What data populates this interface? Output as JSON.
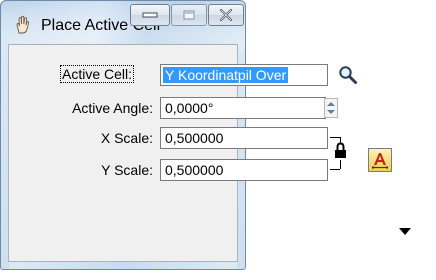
{
  "window": {
    "title": "Place Active Cell"
  },
  "form": {
    "active_cell_label": "Active Cell:",
    "active_cell_value": "Y Koordinatpil Over",
    "active_angle_label": "Active Angle:",
    "active_angle_value": "0,0000°",
    "x_scale_label": "X Scale:",
    "x_scale_value": "0,500000",
    "y_scale_label": "Y Scale:",
    "y_scale_value": "0,500000"
  },
  "icons": {
    "title": "hand-cell-icon",
    "browse": "magnifier-icon",
    "lock": "padlock-icon",
    "annotation": "text-annotation-icon",
    "more": "dropdown-arrow-icon"
  },
  "colors": {
    "selection": "#3399ff",
    "frame": "#cfdfee",
    "client": "#f0f0f0"
  }
}
